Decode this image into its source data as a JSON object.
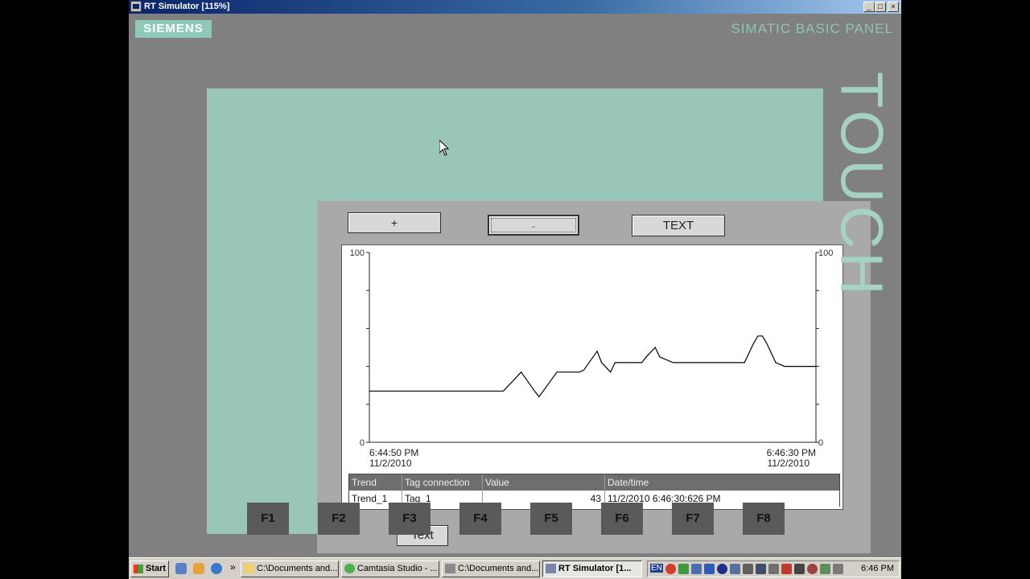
{
  "window": {
    "title": "RT Simulator [115%]",
    "minimize": "_",
    "maximize": "□",
    "close": "×"
  },
  "panel": {
    "brand_logo": "SIEMENS",
    "model": "SIMATIC BASIC PANEL",
    "side_label": "TOUCH"
  },
  "buttons": {
    "plus": "+",
    "minus": "-",
    "text_top": "TEXT",
    "text_bottom": "Text"
  },
  "chart_data": {
    "type": "line",
    "ylim": [
      0,
      100
    ],
    "y_ticks_left": [
      "100",
      "0"
    ],
    "y_ticks_right": [
      "100",
      "0"
    ],
    "x_start": {
      "time": "6:44:50 PM",
      "date": "11/2/2010"
    },
    "x_end": {
      "time": "6:46:30 PM",
      "date": "11/2/2010"
    },
    "series": [
      {
        "x": [
          0,
          27,
          30,
          34,
          37,
          38,
          42,
          45,
          47,
          48,
          51,
          52,
          54,
          55,
          59,
          60,
          61,
          62,
          64,
          65,
          68,
          70,
          84,
          86,
          87,
          88,
          89,
          91,
          93,
          100
        ],
        "values": [
          27,
          27,
          27,
          37,
          27,
          24,
          37,
          37,
          37,
          38,
          48,
          42,
          37,
          42,
          42,
          42,
          42,
          45,
          50,
          45,
          42,
          42,
          42,
          52,
          56,
          56,
          52,
          42,
          40,
          40
        ]
      }
    ]
  },
  "table": {
    "headers": [
      "Trend",
      "Tag connection",
      "Value",
      "Date/time"
    ],
    "rows": [
      [
        "Trend_1",
        "Tag_1",
        "43",
        "11/2/2010 6:46:30:626 PM"
      ]
    ]
  },
  "function_keys": [
    "F1",
    "F2",
    "F3",
    "F4",
    "F5",
    "F6",
    "F7",
    "F8"
  ],
  "taskbar": {
    "start": "Start",
    "chevron": "»",
    "tasks": [
      "C:\\Documents and...",
      "Camtasia Studio - ...",
      "C:\\Documents and...",
      "RT Simulator [1..."
    ],
    "tray_language": "EN",
    "clock": "6:46 PM"
  },
  "colors": {
    "bezel": "#9ac6b9",
    "display": "#a9a9a9",
    "trend_line": "#000000",
    "titlebar": "#0a246a"
  }
}
